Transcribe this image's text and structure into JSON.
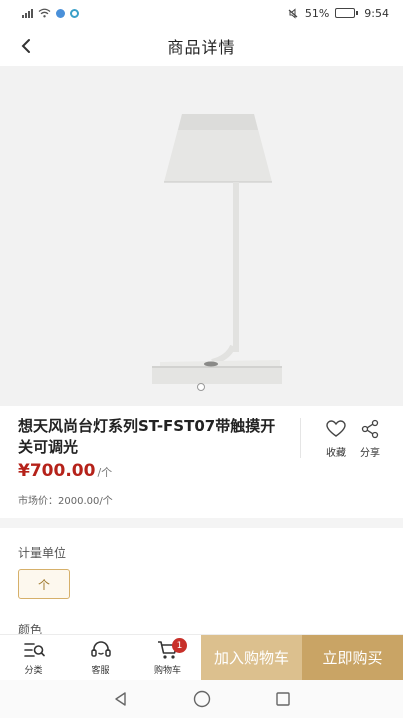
{
  "status_bar": {
    "battery_pct": "51%",
    "time": "9:54",
    "battery_level": 0.51
  },
  "nav": {
    "title": "商品详情"
  },
  "product": {
    "title": "想天风尚台灯系列ST-FST07带触摸开关可调光",
    "price": "¥700.00",
    "price_unit": "/个",
    "market_price": "市场价：2000.00/个",
    "image_icon": "desk-lamp-image",
    "carousel": {
      "count": 1,
      "active": 0
    }
  },
  "actions": {
    "favorite_label": "收藏",
    "share_label": "分享"
  },
  "spec": {
    "unit_label": "计量单位",
    "unit_option": "个",
    "color_label": "颜色"
  },
  "bottom_bar": {
    "category_label": "分类",
    "service_label": "客服",
    "cart_label": "购物车",
    "cart_count": "1",
    "add_to_cart_label": "加入购物车",
    "buy_now_label": "立即购买"
  },
  "colors": {
    "price": "#b5221a",
    "add_to_cart_bg": "#dcc08e",
    "buy_now_bg": "#c9a465",
    "badge": "#c8302a",
    "selected_option_border": "#d6b06a"
  }
}
